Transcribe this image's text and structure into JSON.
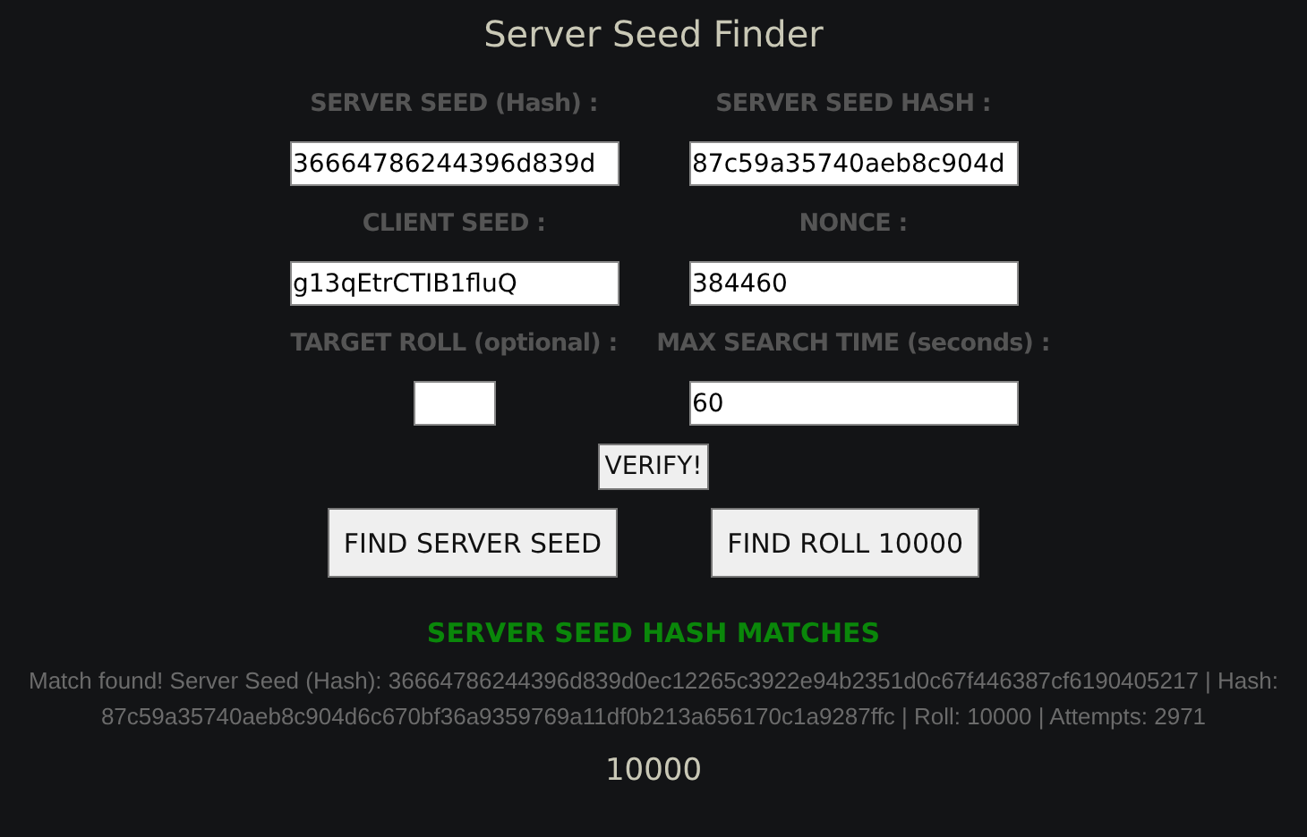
{
  "title": "Server Seed Finder",
  "fields": [
    {
      "label": "SERVER SEED (Hash) :",
      "value": "36664786244396d839d",
      "kind": "wide"
    },
    {
      "label": "SERVER SEED HASH :",
      "value": "87c59a35740aeb8c904d",
      "kind": "wide"
    },
    {
      "label": "CLIENT SEED :",
      "value": "g13qEtrCTIB1fluQ",
      "kind": "wide"
    },
    {
      "label": "NONCE :",
      "value": "384460",
      "kind": "wide"
    },
    {
      "label": "TARGET ROLL (optional) :",
      "kind": "narrow"
    },
    {
      "label": "MAX SEARCH TIME (seconds) :",
      "value": "60",
      "kind": "wide"
    }
  ],
  "verify_button": "VERIFY!",
  "action_buttons": [
    "FIND SERVER SEED",
    "FIND ROLL 10000"
  ],
  "status": {
    "message": "SERVER SEED HASH MATCHES",
    "details": "Match found! Server Seed (Hash): 36664786244396d839d0ec12265c3922e94b2351d0c67f446387cf6190405217 | Hash: 87c59a35740aeb8c904d6c670bf36a9359769a11df0b213a656170c1a9287ffc | Roll: 10000 | Attempts: 2971",
    "result": "10000"
  }
}
